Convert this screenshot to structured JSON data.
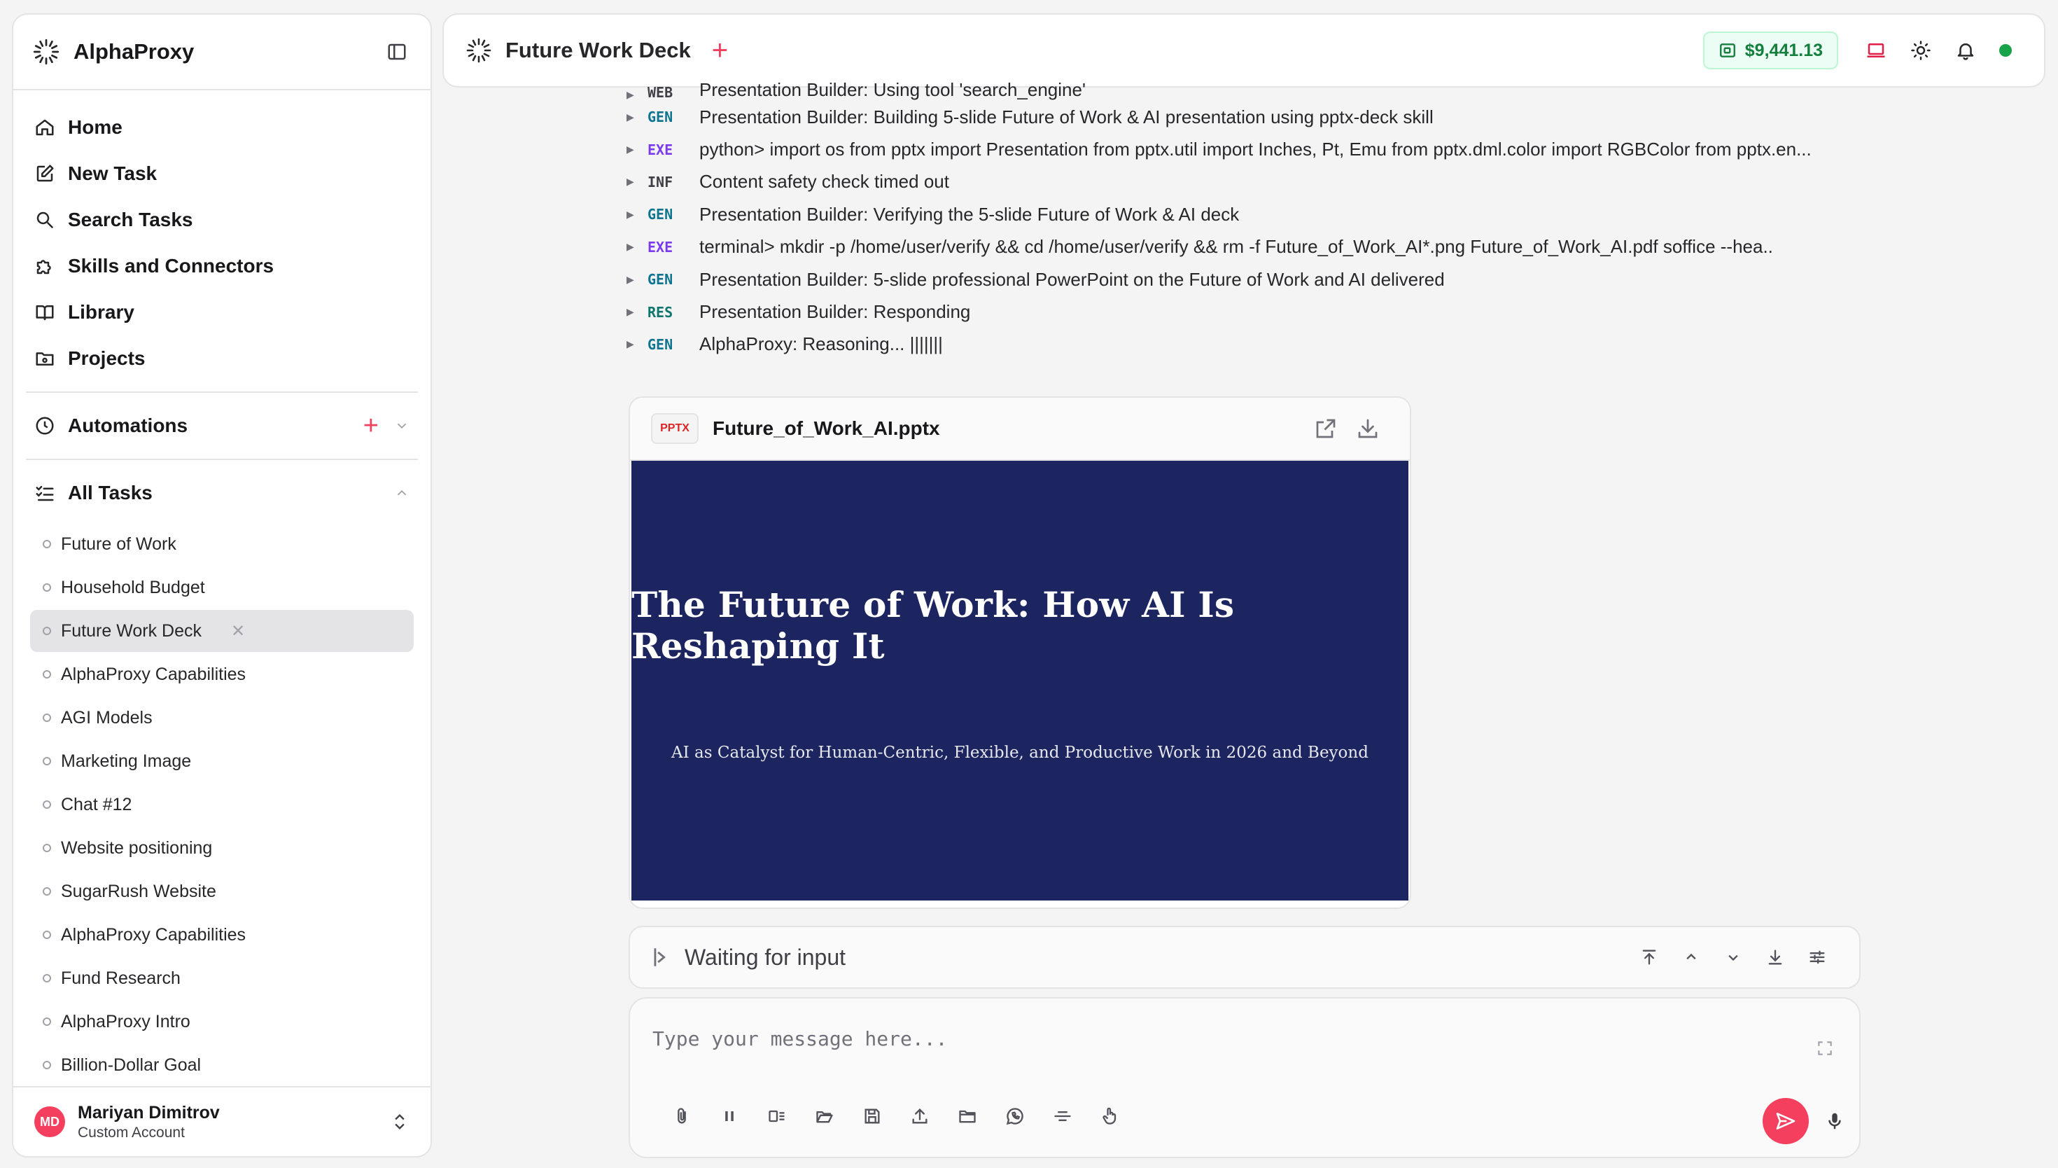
{
  "app": {
    "brand": "AlphaProxy"
  },
  "sidebar": {
    "nav": [
      {
        "label": "Home",
        "icon": "home-icon"
      },
      {
        "label": "New Task",
        "icon": "edit-icon"
      },
      {
        "label": "Search Tasks",
        "icon": "search-icon"
      },
      {
        "label": "Skills and Connectors",
        "icon": "puzzle-icon"
      },
      {
        "label": "Library",
        "icon": "book-icon"
      },
      {
        "label": "Projects",
        "icon": "folder-icon"
      }
    ],
    "automations_label": "Automations",
    "all_tasks_label": "All Tasks",
    "tasks": [
      "Future of Work",
      "Household Budget",
      "Future Work Deck",
      "AlphaProxy Capabilities",
      "AGI Models",
      "Marketing Image",
      "Chat #12",
      "Website positioning",
      "SugarRush Website",
      "AlphaProxy Capabilities",
      "Fund Research",
      "AlphaProxy Intro",
      "Billion-Dollar Goal"
    ],
    "active_task": "Future Work Deck",
    "user": {
      "initials": "MD",
      "name": "Mariyan Dimitrov",
      "account": "Custom Account"
    }
  },
  "header": {
    "title": "Future Work Deck",
    "balance": "$9,441.13",
    "colors": {
      "accent": "#f43f5e",
      "balance": "#15803d",
      "status": "#16a34a"
    }
  },
  "log": [
    {
      "tag": "WEB",
      "color": "#3f3f46",
      "text": "Presentation Builder: Using tool 'search_engine'"
    },
    {
      "tag": "GEN",
      "color": "#0e7490",
      "text": "Presentation Builder: Building 5-slide Future of Work & AI presentation using pptx-deck skill"
    },
    {
      "tag": "EXE",
      "color": "#7c3aed",
      "text": "python> import os from pptx import Presentation from pptx.util import Inches, Pt, Emu from pptx.dml.color import RGBColor from pptx.en..."
    },
    {
      "tag": "INF",
      "color": "#3f3f46",
      "text": "Content safety check timed out"
    },
    {
      "tag": "GEN",
      "color": "#0e7490",
      "text": "Presentation Builder: Verifying the 5-slide Future of Work & AI deck"
    },
    {
      "tag": "EXE",
      "color": "#7c3aed",
      "text": "terminal> mkdir -p /home/user/verify && cd /home/user/verify && rm -f Future_of_Work_AI*.png Future_of_Work_AI.pdf soffice --hea.."
    },
    {
      "tag": "GEN",
      "color": "#0e7490",
      "text": "Presentation Builder: 5-slide professional PowerPoint on the Future of Work and AI delivered"
    },
    {
      "tag": "RES",
      "color": "#0f766e",
      "text": "Presentation Builder: Responding"
    },
    {
      "tag": "GEN",
      "color": "#0e7490",
      "text": "AlphaProxy: Reasoning... |||||||"
    }
  ],
  "file": {
    "badge": "PPTX",
    "name": "Future_of_Work_AI.pptx",
    "slide_title": "The Future of Work: How AI Is Reshaping It",
    "slide_subtitle": "AI as Catalyst for Human-Centric, Flexible, and Productive Work in 2026 and Beyond",
    "slide_bg": "#1d2560"
  },
  "waiting": {
    "text": "Waiting for input"
  },
  "composer": {
    "placeholder": "Type your message here..."
  }
}
